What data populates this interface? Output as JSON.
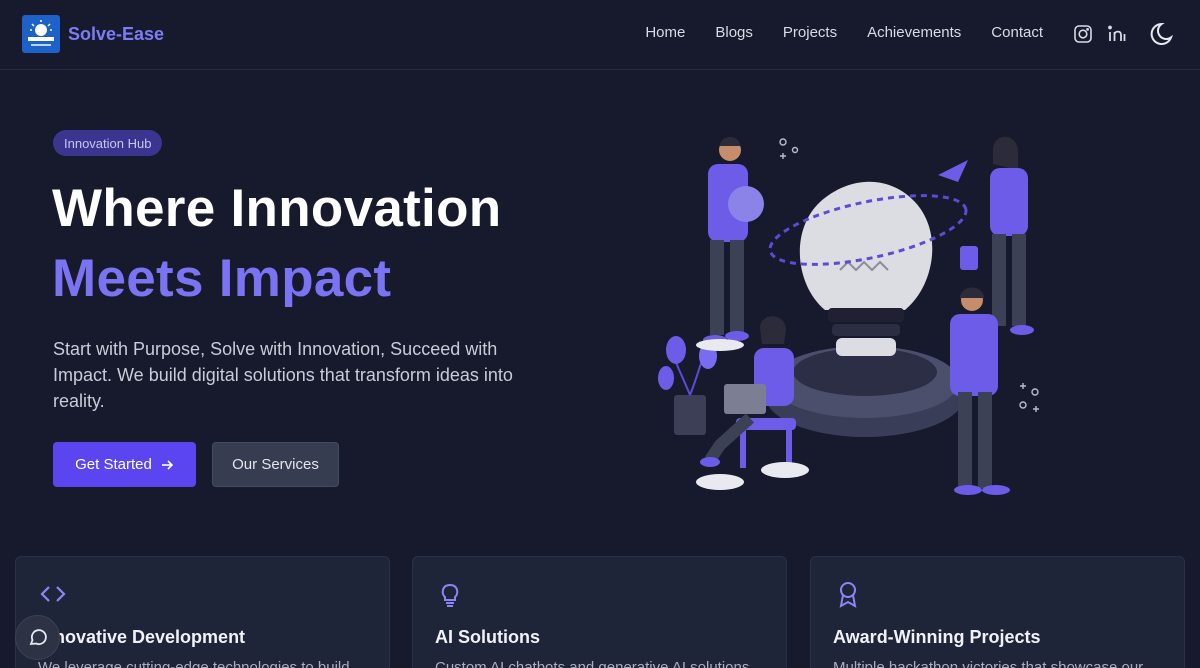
{
  "brand": {
    "name": "Solve-Ease"
  },
  "nav": {
    "links": [
      "Home",
      "Blogs",
      "Projects",
      "Achievements",
      "Contact"
    ],
    "icons": [
      "instagram-icon",
      "linkedin-icon",
      "moon-icon"
    ]
  },
  "hero": {
    "badge": "Innovation Hub",
    "headline_line1": "Where Innovation",
    "headline_line2": "Meets Impact",
    "description": "Start with Purpose, Solve with Innovation, Succeed with Impact. We build digital solutions that transform ideas into reality.",
    "primary_button": "Get Started",
    "secondary_button": "Our Services"
  },
  "features": [
    {
      "icon": "code-icon",
      "title": "Innovative Development",
      "desc": "We leverage cutting-edge technologies to build"
    },
    {
      "icon": "lightbulb-icon",
      "title": "AI Solutions",
      "desc": "Custom AI chatbots and generative AI solutions"
    },
    {
      "icon": "award-icon",
      "title": "Award-Winning Projects",
      "desc": "Multiple hackathon victories that showcase our"
    }
  ],
  "colors": {
    "background": "#161a2c",
    "accent": "#5b45f0",
    "accent_text": "#7a74f3",
    "card": "#1f2538"
  }
}
